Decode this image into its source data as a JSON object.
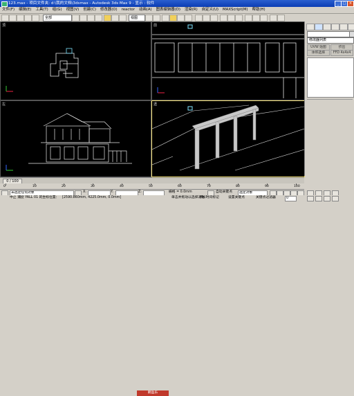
{
  "titlebar": {
    "text": "123.max - 项目文件夹: d:\\我的文档\\3dsmax - Autodesk 3ds Max 9 - 显示 : 软件"
  },
  "menu": [
    "文件(F)",
    "编辑(E)",
    "工具(T)",
    "组(G)",
    "视图(V)",
    "创建(C)",
    "修改器(O)",
    "reactor",
    "动画(A)",
    "图表编辑器(D)",
    "渲染(R)",
    "自定义(U)",
    "MAXScript(M)",
    "帮助(H)"
  ],
  "toolbar": {
    "filter_select": "全部",
    "view_select": "视图"
  },
  "viewports": {
    "top": "顶",
    "front": "前",
    "left": "左",
    "perspective": "透"
  },
  "command_panel": {
    "object_name": "",
    "modifier_list": "修改器列表",
    "buttons": [
      "UVW 贴图",
      "挤出",
      "体积选择",
      "FFD 4x4x4"
    ]
  },
  "timeline": {
    "frame": "0 / 100",
    "ticks": [
      "0",
      "10",
      "20",
      "30",
      "40",
      "50",
      "60",
      "70",
      "80",
      "90",
      "100"
    ]
  },
  "status": {
    "selection": "未选定任何对象",
    "x_label": "X:",
    "y_label": "Y:",
    "z_label": "Z:",
    "grid": "栅格 = 0.0mm",
    "auto_key": "自动关键点",
    "selected_set": "选定对象",
    "set_key": "设置关键点",
    "key_filters": "关键点过滤器",
    "frame_counter": "0",
    "prompt": "单击并拖动以选择对象",
    "add_time_tag": "添加时间标记",
    "left_prompt": "中止 捕捉 YALL 01 的坐标位置：",
    "coords": "[2590.860mm, 4225.0mm, 0.0mm]",
    "logo": "朗盈乐"
  }
}
